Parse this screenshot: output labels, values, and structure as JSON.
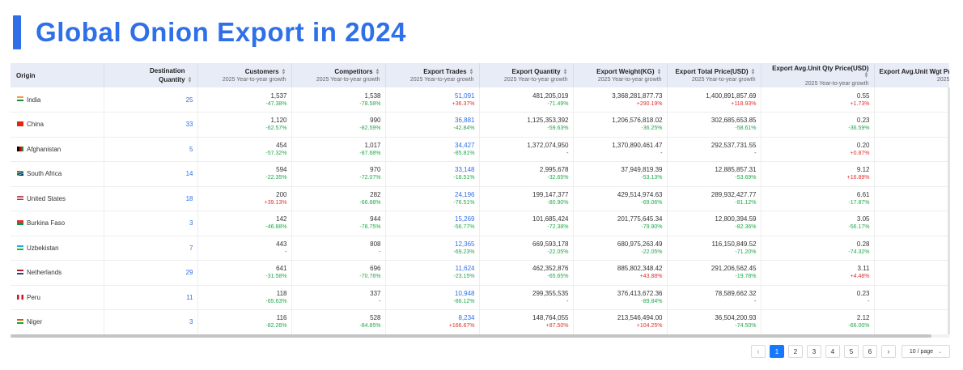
{
  "page_title": "Global Onion Export in 2024",
  "colors": {
    "accent": "#2f6fe8",
    "increase": "#e0302b",
    "decrease": "#20a84b",
    "header_bg": "#e8ecf7"
  },
  "table": {
    "headers": {
      "origin": "Origin",
      "destination": "Destination Quantity",
      "customers": "Customers",
      "competitors": "Competitors",
      "trades": "Export Trades",
      "quantity": "Export Quantity",
      "weight": "Export Weight(KG)",
      "total_price": "Export Total Price(USD)",
      "avg_qty_price": "Export Avg.Unit Qty Price(USD)",
      "avg_wgt_price": "Export Avg.Unit Wgt Pri",
      "growth_sub": "2025 Year-to-year growth"
    },
    "rows": [
      {
        "origin": "India",
        "flag": "flag-india",
        "dest": "25",
        "customers": {
          "value": "1,537",
          "growth": "-47.38%"
        },
        "competitors": {
          "value": "1,538",
          "growth": "-78.58%"
        },
        "trades": {
          "value": "51,091",
          "growth": "+36.37%"
        },
        "quantity": {
          "value": "481,205,019",
          "growth": "-71.49%"
        },
        "weight": {
          "value": "3,368,281,877.73",
          "growth": "+290.19%"
        },
        "total_price": {
          "value": "1,400,891,857.69",
          "growth": "+118.93%"
        },
        "avg_qty_price": {
          "value": "0.55",
          "growth": "+1.73%"
        }
      },
      {
        "origin": "China",
        "flag": "flag-china",
        "dest": "33",
        "customers": {
          "value": "1,120",
          "growth": "-62.57%"
        },
        "competitors": {
          "value": "990",
          "growth": "-82.59%"
        },
        "trades": {
          "value": "36,881",
          "growth": "-42.84%"
        },
        "quantity": {
          "value": "1,125,353,392",
          "growth": "-59.63%"
        },
        "weight": {
          "value": "1,206,576,818.02",
          "growth": "-36.25%"
        },
        "total_price": {
          "value": "302,685,653.85",
          "growth": "-58.61%"
        },
        "avg_qty_price": {
          "value": "0.23",
          "growth": "-36.59%"
        }
      },
      {
        "origin": "Afghanistan",
        "flag": "flag-afghanistan",
        "dest": "5",
        "customers": {
          "value": "454",
          "growth": "-57.32%"
        },
        "competitors": {
          "value": "1,017",
          "growth": "-87.68%"
        },
        "trades": {
          "value": "34,427",
          "growth": "-85.81%"
        },
        "quantity": {
          "value": "1,372,074,950",
          "growth": "-"
        },
        "weight": {
          "value": "1,370,890,461.47",
          "growth": "-"
        },
        "total_price": {
          "value": "292,537,731.55",
          "growth": "-"
        },
        "avg_qty_price": {
          "value": "0.20",
          "growth": "+0.87%"
        }
      },
      {
        "origin": "South Africa",
        "flag": "flag-south-africa",
        "dest": "14",
        "customers": {
          "value": "594",
          "growth": "-22.35%"
        },
        "competitors": {
          "value": "970",
          "growth": "-72.07%"
        },
        "trades": {
          "value": "33,148",
          "growth": "-18.51%"
        },
        "quantity": {
          "value": "2,995,678",
          "growth": "-32.65%"
        },
        "weight": {
          "value": "37,949,819.39",
          "growth": "-53.13%"
        },
        "total_price": {
          "value": "12,885,857.31",
          "growth": "-53.69%"
        },
        "avg_qty_price": {
          "value": "9.12",
          "growth": "+16.89%"
        }
      },
      {
        "origin": "United States",
        "flag": "flag-united-states",
        "dest": "18",
        "customers": {
          "value": "200",
          "growth": "+39.13%"
        },
        "competitors": {
          "value": "282",
          "growth": "-66.88%"
        },
        "trades": {
          "value": "24,196",
          "growth": "-76.51%"
        },
        "quantity": {
          "value": "199,147,377",
          "growth": "-80.90%"
        },
        "weight": {
          "value": "429,514,974.63",
          "growth": "-69.06%"
        },
        "total_price": {
          "value": "289,932,427.77",
          "growth": "-81.12%"
        },
        "avg_qty_price": {
          "value": "6.61",
          "growth": "-17.87%"
        }
      },
      {
        "origin": "Burkina Faso",
        "flag": "flag-burkina-faso",
        "dest": "3",
        "customers": {
          "value": "142",
          "growth": "-46.88%"
        },
        "competitors": {
          "value": "944",
          "growth": "-78.75%"
        },
        "trades": {
          "value": "15,269",
          "growth": "-56.77%"
        },
        "quantity": {
          "value": "101,685,424",
          "growth": "-72.38%"
        },
        "weight": {
          "value": "201,775,645.34",
          "growth": "-79.90%"
        },
        "total_price": {
          "value": "12,800,394.59",
          "growth": "-82.36%"
        },
        "avg_qty_price": {
          "value": "3.05",
          "growth": "-56.17%"
        }
      },
      {
        "origin": "Uzbekistan",
        "flag": "flag-uzbekistan",
        "dest": "7",
        "customers": {
          "value": "443",
          "growth": "-"
        },
        "competitors": {
          "value": "808",
          "growth": "-"
        },
        "trades": {
          "value": "12,365",
          "growth": "-69.23%"
        },
        "quantity": {
          "value": "669,593,178",
          "growth": "-22.05%"
        },
        "weight": {
          "value": "680,975,263.49",
          "growth": "-22.05%"
        },
        "total_price": {
          "value": "116,150,849.52",
          "growth": "-71.20%"
        },
        "avg_qty_price": {
          "value": "0.28",
          "growth": "-74.32%"
        }
      },
      {
        "origin": "Netherlands",
        "flag": "flag-netherlands",
        "dest": "29",
        "customers": {
          "value": "641",
          "growth": "-31.58%"
        },
        "competitors": {
          "value": "696",
          "growth": "-70.76%"
        },
        "trades": {
          "value": "11,624",
          "growth": "-23.15%"
        },
        "quantity": {
          "value": "462,352,876",
          "growth": "-65.65%"
        },
        "weight": {
          "value": "885,802,348.42",
          "growth": "+43.88%"
        },
        "total_price": {
          "value": "291,206,562.45",
          "growth": "-19.78%"
        },
        "avg_qty_price": {
          "value": "3.11",
          "growth": "+4.48%"
        }
      },
      {
        "origin": "Peru",
        "flag": "flag-peru",
        "dest": "11",
        "customers": {
          "value": "118",
          "growth": "-65.63%"
        },
        "competitors": {
          "value": "337",
          "growth": "-"
        },
        "trades": {
          "value": "10,948",
          "growth": "-86.12%"
        },
        "quantity": {
          "value": "299,355,535",
          "growth": "-"
        },
        "weight": {
          "value": "376,413,672.36",
          "growth": "-89.84%"
        },
        "total_price": {
          "value": "78,589,662.32",
          "growth": "-"
        },
        "avg_qty_price": {
          "value": "0.23",
          "growth": "-"
        }
      },
      {
        "origin": "Niger",
        "flag": "flag-niger",
        "dest": "3",
        "customers": {
          "value": "116",
          "growth": "-82.26%"
        },
        "competitors": {
          "value": "528",
          "growth": "-84.85%"
        },
        "trades": {
          "value": "8,234",
          "growth": "+166.67%"
        },
        "quantity": {
          "value": "148,764,055",
          "growth": "+87.50%"
        },
        "weight": {
          "value": "213,546,494.00",
          "growth": "+104.25%"
        },
        "total_price": {
          "value": "36,504,200.93",
          "growth": "-74.50%"
        },
        "avg_qty_price": {
          "value": "2.12",
          "growth": "-66.00%"
        }
      }
    ]
  },
  "pagination": {
    "prev_icon": "‹",
    "next_icon": "›",
    "pages": [
      "1",
      "2",
      "3",
      "4",
      "5",
      "6"
    ],
    "current": "1",
    "page_size": "10 / page"
  }
}
